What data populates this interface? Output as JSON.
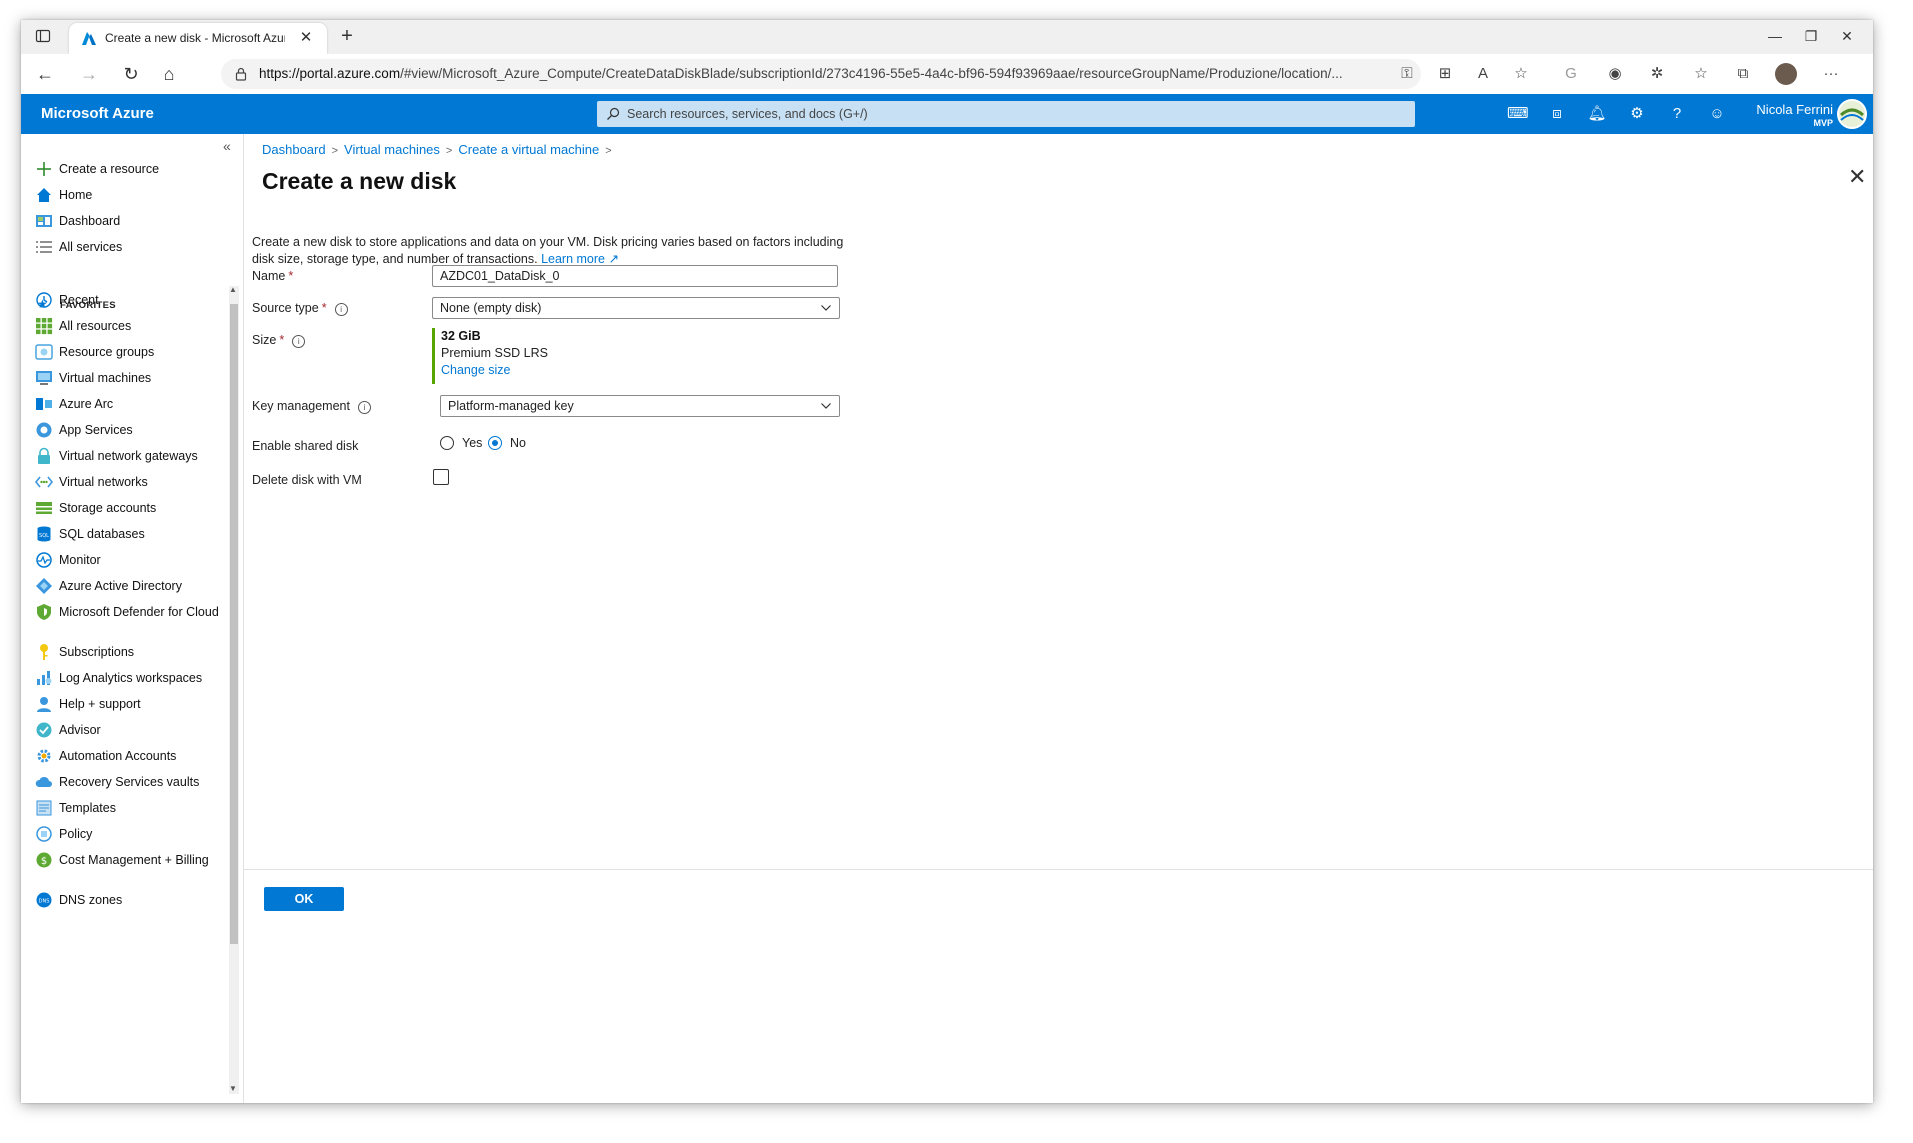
{
  "browser": {
    "tab_title": "Create a new disk - Microsoft Azure",
    "tab_close": "✕",
    "new_tab": "+",
    "url_host": "https://portal.azure.com",
    "url_path": "/#view/Microsoft_Azure_Compute/CreateDataDiskBlade/subscriptionId/273c4196-55e5-4a4c-bf96-594f93969aae/resourceGroupName/Produzione/location/..."
  },
  "header": {
    "brand": "Microsoft Azure",
    "search_placeholder": "Search resources, services, and docs (G+/)",
    "user_name": "Nicola Ferrini",
    "user_role": "MVP"
  },
  "sidebar": {
    "collapse": "«",
    "create_resource": "Create a resource",
    "home": "Home",
    "dashboard": "Dashboard",
    "all_services": "All services",
    "favorites_label": "FAVORITES",
    "items": [
      {
        "label": "Recent",
        "icon": "clock-icon"
      },
      {
        "label": "All resources",
        "icon": "grid-icon"
      },
      {
        "label": "Resource groups",
        "icon": "resource-group-icon"
      },
      {
        "label": "Virtual machines",
        "icon": "virtual-machine-icon"
      },
      {
        "label": "Azure Arc",
        "icon": "azure-arc-icon"
      },
      {
        "label": "App Services",
        "icon": "app-services-icon"
      },
      {
        "label": "Virtual network gateways",
        "icon": "lock-icon"
      },
      {
        "label": "Virtual networks",
        "icon": "network-icon"
      },
      {
        "label": "Storage accounts",
        "icon": "storage-icon"
      },
      {
        "label": "SQL databases",
        "icon": "sql-icon"
      },
      {
        "label": "Monitor",
        "icon": "monitor-icon"
      },
      {
        "label": "Azure Active Directory",
        "icon": "aad-icon"
      },
      {
        "label": "Microsoft Defender for Cloud",
        "icon": "shield-icon"
      },
      {
        "label": "Subscriptions",
        "icon": "key-icon"
      },
      {
        "label": "Log Analytics workspaces",
        "icon": "analytics-icon"
      },
      {
        "label": "Help + support",
        "icon": "support-icon"
      },
      {
        "label": "Advisor",
        "icon": "advisor-icon"
      },
      {
        "label": "Automation Accounts",
        "icon": "gear-icon"
      },
      {
        "label": "Recovery Services vaults",
        "icon": "cloud-icon"
      },
      {
        "label": "Templates",
        "icon": "template-icon"
      },
      {
        "label": "Policy",
        "icon": "policy-icon"
      },
      {
        "label": "Cost Management + Billing",
        "icon": "cost-icon"
      },
      {
        "label": "DNS zones",
        "icon": "dns-icon"
      }
    ]
  },
  "breadcrumb": [
    "Dashboard",
    "Virtual machines",
    "Create a virtual machine"
  ],
  "blade": {
    "title": "Create a new disk",
    "more": "···",
    "close": "✕",
    "description": "Create a new disk to store applications and data on your VM. Disk pricing varies based on factors including disk size, storage type, and number of transactions.",
    "learn_more": "Learn more",
    "name_label": "Name",
    "name_value": "AZDC01_DataDisk_0",
    "source_type_label": "Source type",
    "source_type_value": "None (empty disk)",
    "size_label": "Size",
    "size_value": "32 GiB",
    "size_sku": "Premium SSD LRS",
    "change_size": "Change size",
    "key_mgmt_label": "Key management",
    "key_mgmt_value": "Platform-managed key",
    "shared_disk_label": "Enable shared disk",
    "shared_yes": "Yes",
    "shared_no": "No",
    "shared_selected": "No",
    "delete_with_vm_label": "Delete disk with VM",
    "delete_with_vm_checked": false,
    "ok": "OK"
  },
  "colors": {
    "accent": "#0078d4",
    "header_bg": "#0078d4",
    "size_bar": "#57a300",
    "required": "#a4262c"
  }
}
